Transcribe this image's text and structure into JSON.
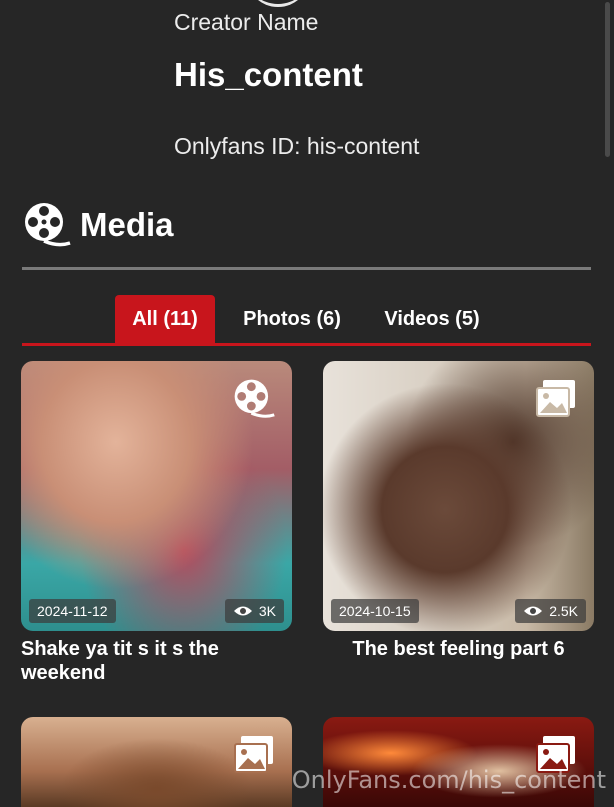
{
  "profile": {
    "creator_label": "Creator Name",
    "creator_name": "His_content",
    "onlyfans_id": "Onlyfans ID: his-content"
  },
  "media": {
    "title": "Media",
    "icon": "film-reel-icon"
  },
  "tabs": [
    {
      "label": "All (11)",
      "active": true
    },
    {
      "label": "Photos (6)",
      "active": false
    },
    {
      "label": "Videos (5)",
      "active": false
    }
  ],
  "items": [
    {
      "type": "video",
      "icon": "film-reel-icon",
      "date": "2024-11-12",
      "views": "3K",
      "title": "Shake ya tit s it s the weekend"
    },
    {
      "type": "photo",
      "icon": "image-icon",
      "date": "2024-10-15",
      "views": "2.5K",
      "title": "The best feeling part 6"
    },
    {
      "type": "photo",
      "icon": "image-icon"
    },
    {
      "type": "photo",
      "icon": "image-icon"
    }
  ],
  "watermark": "OnlyFans.com/his_content",
  "colors": {
    "background": "#262626",
    "accent": "#c8151c",
    "divider": "#7a7a7a"
  }
}
